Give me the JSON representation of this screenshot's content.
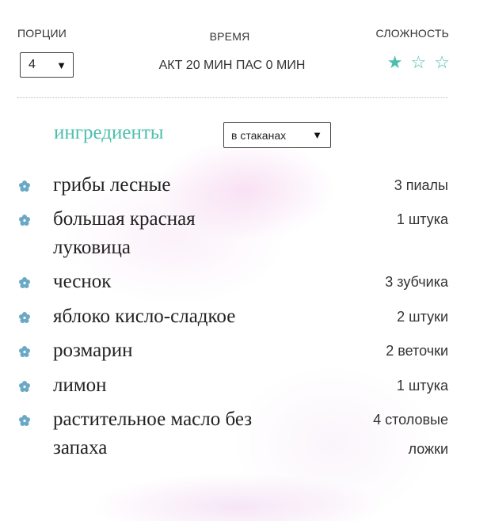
{
  "meta": {
    "portions_label": "ПОРЦИИ",
    "portions_value": "4",
    "time_label": "ВРЕМЯ",
    "time_value": "АКТ 20 МИН ПАС 0 МИН",
    "difficulty_label": "СЛОЖНОСТЬ",
    "difficulty_level": 1,
    "difficulty_max": 3
  },
  "ingredients_section": {
    "title": "ингредиенты",
    "unit_selected": "в стаканах"
  },
  "ingredients": [
    {
      "name": "грибы лесные",
      "qty": "3 пиалы"
    },
    {
      "name": "большая красная луковица",
      "qty": "1 штука"
    },
    {
      "name": "чеснок",
      "qty": "3 зубчика"
    },
    {
      "name": "яблоко кисло-сладкое",
      "qty": "2 штуки"
    },
    {
      "name": "розмарин",
      "qty": "2 веточки"
    },
    {
      "name": "лимон",
      "qty": "1 штука"
    },
    {
      "name": "растительное масло без запаха",
      "qty": "4 столовые ложки"
    }
  ],
  "colors": {
    "accent": "#4bbfae",
    "bullet": "#6aa9c4"
  },
  "icons": {
    "bullet": "flower-icon",
    "star_full": "star-filled-icon",
    "star_empty": "star-outline-icon",
    "dropdown": "caret-down-icon"
  }
}
